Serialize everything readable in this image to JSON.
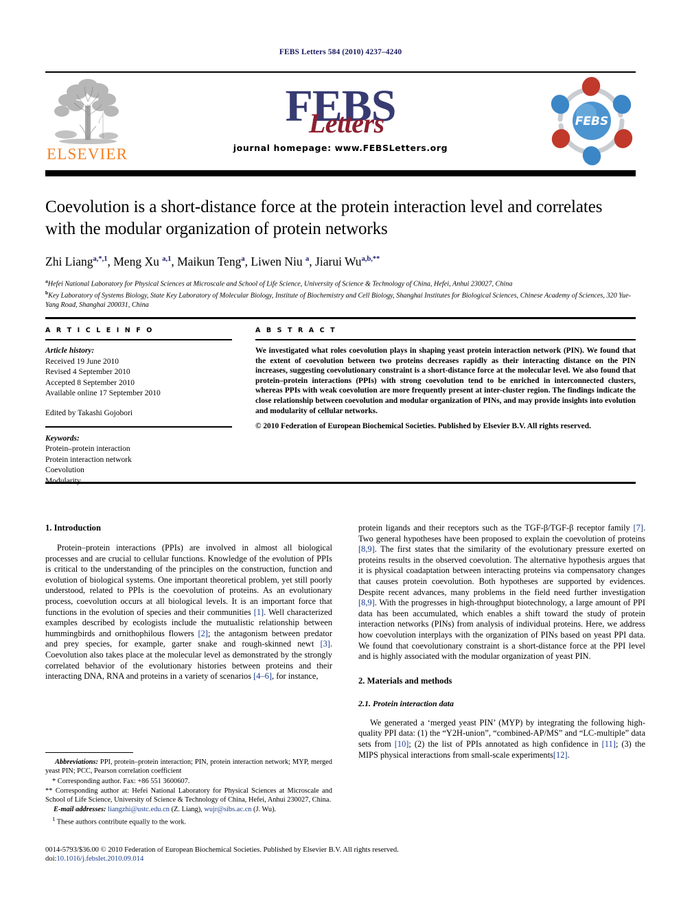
{
  "running_head": "FEBS Letters 584 (2010) 4237–4240",
  "masthead": {
    "elsevier_wordmark": "ELSEVIER",
    "journal_name_main": "FEBS",
    "journal_name_script": "Letters",
    "homepage": "journal homepage: www.FEBSLetters.org",
    "febs_logo_text": "FEBS",
    "colors": {
      "elsevier_orange": "#F57F20",
      "febs_navy": "#373B72",
      "febs_red": "#8C2030",
      "logo_blue": "#3B86C6",
      "logo_red": "#C0392B",
      "link_blue": "#1a3c8c"
    }
  },
  "title": "Coevolution is a short-distance force at the protein interaction level and correlates with the modular organization of protein networks",
  "authors": [
    {
      "name": "Zhi Liang",
      "sup": "a,*,1"
    },
    {
      "name": "Meng Xu",
      "sup": "a,1"
    },
    {
      "name": "Maikun Teng",
      "sup": "a"
    },
    {
      "name": "Liwen Niu",
      "sup": "a"
    },
    {
      "name": "Jiarui Wu",
      "sup": "a,b,**"
    }
  ],
  "affiliations": [
    {
      "marker": "a",
      "text": "Hefei National Laboratory for Physical Sciences at Microscale and School of Life Science, University of Science & Technology of China, Hefei, Anhui 230027, China"
    },
    {
      "marker": "b",
      "text": "Key Laboratory of Systems Biology, State Key Laboratory of Molecular Biology, Institute of Biochemistry and Cell Biology, Shanghai Institutes for Biological Sciences, Chinese Academy of Sciences, 320 Yue-Yang Road, Shanghai 200031, China"
    }
  ],
  "article_info": {
    "heading": "A R T I C L E     I N F O",
    "history_label": "Article history:",
    "history": [
      "Received 19 June 2010",
      "Revised 4 September 2010",
      "Accepted 8 September 2010",
      "Available online 17 September 2010"
    ],
    "edited_by": "Edited by Takashi Gojobori",
    "keywords_label": "Keywords:",
    "keywords": [
      "Protein–protein interaction",
      "Protein interaction network",
      "Coevolution",
      "Modularity"
    ]
  },
  "abstract": {
    "heading": "A B S T R A C T",
    "text": "We investigated what roles coevolution plays in shaping yeast protein interaction network (PIN). We found that the extent of coevolution between two proteins decreases rapidly as their interacting distance on the PIN increases, suggesting coevolutionary constraint is a short-distance force at the molecular level. We also found that protein–protein interactions (PPIs) with strong coevolution tend to be enriched in interconnected clusters, whereas PPIs with weak coevolution are more frequently present at inter-cluster region. The findings indicate the close relationship between coevolution and modular organization of PINs, and may provide insights into evolution and modularity of cellular networks.",
    "copyright": "© 2010 Federation of European Biochemical Societies. Published by Elsevier B.V. All rights reserved."
  },
  "body": {
    "intro_heading": "1. Introduction",
    "intro_p1_a": "Protein–protein interactions (PPIs) are involved in almost all biological processes and are crucial to cellular functions. Knowledge of the evolution of PPIs is critical to the understanding of the principles on the construction, function and evolution of biological systems. One important theoretical problem, yet still poorly understood, related to PPIs is the coevolution of proteins. As an evolutionary process, coevolution occurs at all biological levels. It is an important force that functions in the evolution of species and their communities ",
    "ref1": "[1]",
    "intro_p1_b": ". Well characterized examples described by ecologists include the mutualistic relationship between hummingbirds and ornithophilous flowers ",
    "ref2": "[2]",
    "intro_p1_c": "; the antagonism between predator and prey species, for example, garter snake and rough-skinned newt ",
    "ref3": "[3]",
    "intro_p1_d": ". Coevolution also takes place at the molecular level as demonstrated by the strongly correlated behavior of the evolutionary histories between proteins and their interacting DNA, RNA and proteins in a variety of scenarios ",
    "ref46": "[4–6]",
    "intro_p1_e": ", for instance,",
    "right_p1_a": "protein ligands and their receptors such as the TGF-β/TGF-β receptor family ",
    "ref7": "[7]",
    "right_p1_b": ". Two general hypotheses have been proposed to explain the coevolution of proteins ",
    "ref89": "[8,9]",
    "right_p1_c": ". The first states that the similarity of the evolutionary pressure exerted on proteins results in the observed coevolution. The alternative hypothesis argues that it is physical coadaptation between interacting proteins via compensatory changes that causes protein coevolution. Both hypotheses are supported by evidences. Despite recent advances, many problems in the field need further investigation ",
    "ref89b": "[8,9]",
    "right_p1_d": ". With the progresses in high-throughput biotechnology, a large amount of PPI data has been accumulated, which enables a shift toward the study of protein interaction networks (PINs) from analysis of individual proteins. Here, we address how coevolution interplays with the organization of PINs based on yeast PPI data. We found that coevolutionary constraint is a short-distance force at the PPI level and is highly associated with the modular organization of yeast PIN.",
    "methods_heading": "2. Materials and methods",
    "methods_sub_heading": "2.1. Protein interaction data",
    "methods_p1_a": "We generated a ‘merged yeast PIN’ (MYP) by integrating the following high-quality PPI data: (1) the “Y2H-union”, “combined-AP/MS” and “LC-multiple” data sets from ",
    "ref10": "[10]",
    "methods_p1_b": "; (2) the list of PPIs annotated as high confidence in ",
    "ref11": "[11]",
    "methods_p1_c": "; (3) the MIPS physical interactions from small-scale experiments",
    "ref12": "[12]",
    "methods_p1_d": "."
  },
  "footnotes": {
    "abbrev_label": "Abbreviations:",
    "abbrev_text": " PPI, protein–protein interaction; PIN, protein interaction network; MYP, merged yeast PIN; PCC, Pearson correlation coefficient",
    "corr1_marker": "*",
    "corr1_text": " Corresponding author. Fax: +86 551 3600607.",
    "corr2_marker": "**",
    "corr2_text": " Corresponding author at: Hefei National Laboratory for Physical Sciences at Microscale and School of Life Science, University of Science & Technology of China, Hefei, Anhui 230027, China.",
    "email_label": "E-mail addresses:",
    "email1": "liangzhi@ustc.edu.cn",
    "email1_who": " (Z. Liang), ",
    "email2": "wujr@sibs.ac.cn",
    "email2_who": " (J. Wu).",
    "eq_marker": "1",
    "eq_text": " These authors contribute equally to the work."
  },
  "imprint": {
    "line1": "0014-5793/$36.00 © 2010 Federation of European Biochemical Societies. Published by Elsevier B.V. All rights reserved.",
    "doi_label": "doi:",
    "doi": "10.1016/j.febslet.2010.09.014"
  }
}
